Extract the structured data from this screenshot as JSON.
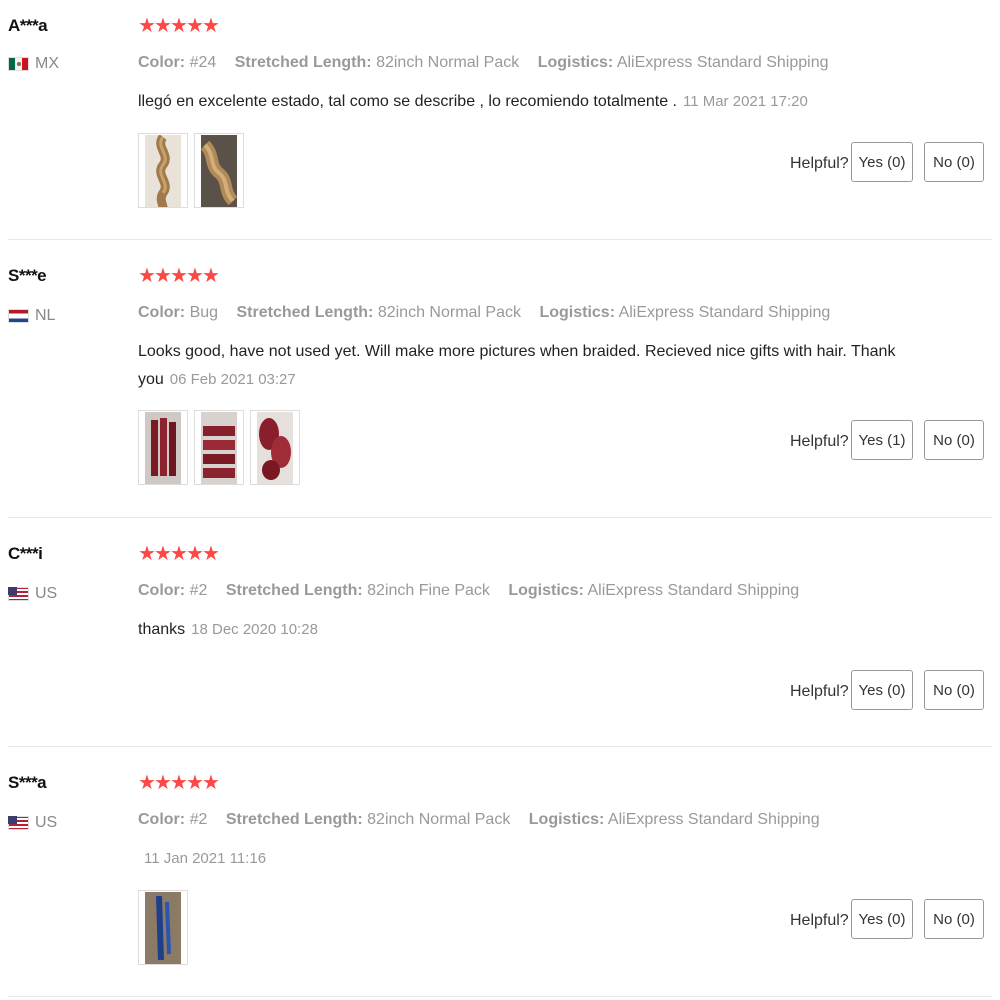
{
  "sku_labels": {
    "color": "Color:",
    "length": "Stretched Length:",
    "logistics": "Logistics:"
  },
  "helpful_label": "Helpful?",
  "rating_star": "★",
  "colors": {
    "star": "#ff4747",
    "muted": "#999999"
  },
  "reviews": [
    {
      "user": "A***a",
      "country": "MX",
      "flag_icon": "flag-mx-icon",
      "rating": 5,
      "color": "#24",
      "length": "82inch Normal Pack",
      "logistics": "AliExpress Standard Shipping",
      "text": "llegó en excelente estado, tal como se describe , lo recomiendo totalmente .",
      "date": "11 Mar 2021 17:20",
      "yes": "Yes (0)",
      "no": "No (0)",
      "photos": [
        "braid-photo",
        "braid-photo"
      ]
    },
    {
      "user": "S***e",
      "country": "NL",
      "flag_icon": "flag-nl-icon",
      "rating": 5,
      "color": "Bug",
      "length": "82inch Normal Pack",
      "logistics": "AliExpress Standard Shipping",
      "text": "Looks good, have not used yet. Will make more pictures when braided. Recieved nice gifts with hair. Thank you",
      "date": "06 Feb 2021 03:27",
      "yes": "Yes (1)",
      "no": "No (0)",
      "photos": [
        "red-hair-photo",
        "red-hair-photo",
        "red-hair-photo"
      ]
    },
    {
      "user": "C***i",
      "country": "US",
      "flag_icon": "flag-us-icon",
      "rating": 5,
      "color": "#2",
      "length": "82inch Fine Pack",
      "logistics": "AliExpress Standard Shipping",
      "text": "thanks",
      "date": "18 Dec 2020 10:28",
      "yes": "Yes (0)",
      "no": "No (0)",
      "photos": []
    },
    {
      "user": "S***a",
      "country": "US",
      "flag_icon": "flag-us-icon",
      "rating": 5,
      "color": "#2",
      "length": "82inch Normal Pack",
      "logistics": "AliExpress Standard Shipping",
      "text": "",
      "date": "11 Jan 2021 11:16",
      "yes": "Yes (0)",
      "no": "No (0)",
      "photos": [
        "blue-hair-photo"
      ]
    }
  ]
}
